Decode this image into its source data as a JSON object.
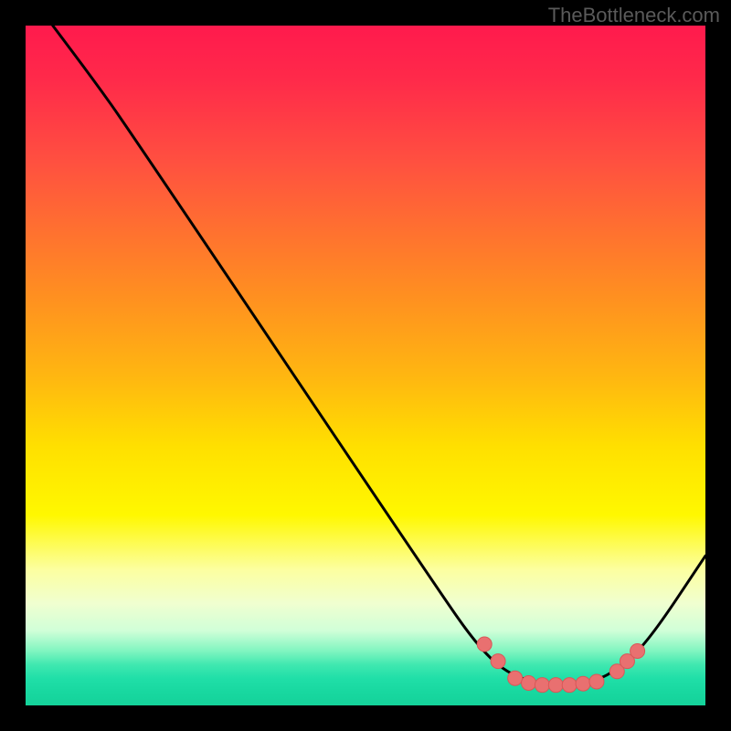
{
  "watermark": "TheBottleneck.com",
  "chart_data": {
    "type": "line",
    "title": "",
    "xlabel": "",
    "ylabel": "",
    "xlim": [
      0,
      100
    ],
    "ylim": [
      0,
      100
    ],
    "grid": false,
    "curve": [
      {
        "x": 4,
        "y": 100
      },
      {
        "x": 10,
        "y": 92
      },
      {
        "x": 15,
        "y": 85
      },
      {
        "x": 60,
        "y": 18
      },
      {
        "x": 67,
        "y": 8
      },
      {
        "x": 72,
        "y": 4
      },
      {
        "x": 78,
        "y": 3
      },
      {
        "x": 84,
        "y": 3.5
      },
      {
        "x": 88,
        "y": 6
      },
      {
        "x": 92,
        "y": 10
      },
      {
        "x": 100,
        "y": 22
      }
    ],
    "markers": [
      {
        "x": 67.5,
        "y": 9
      },
      {
        "x": 69.5,
        "y": 6.5
      },
      {
        "x": 72,
        "y": 4
      },
      {
        "x": 74,
        "y": 3.3
      },
      {
        "x": 76,
        "y": 3
      },
      {
        "x": 78,
        "y": 3
      },
      {
        "x": 80,
        "y": 3
      },
      {
        "x": 82,
        "y": 3.2
      },
      {
        "x": 84,
        "y": 3.5
      },
      {
        "x": 87,
        "y": 5
      },
      {
        "x": 88.5,
        "y": 6.5
      },
      {
        "x": 90,
        "y": 8
      }
    ],
    "gradient_stops": [
      {
        "pos": 0,
        "color": "#ff1a4d"
      },
      {
        "pos": 50,
        "color": "#ffd000"
      },
      {
        "pos": 90,
        "color": "#c0ffd0"
      },
      {
        "pos": 100,
        "color": "#14d29a"
      }
    ]
  }
}
